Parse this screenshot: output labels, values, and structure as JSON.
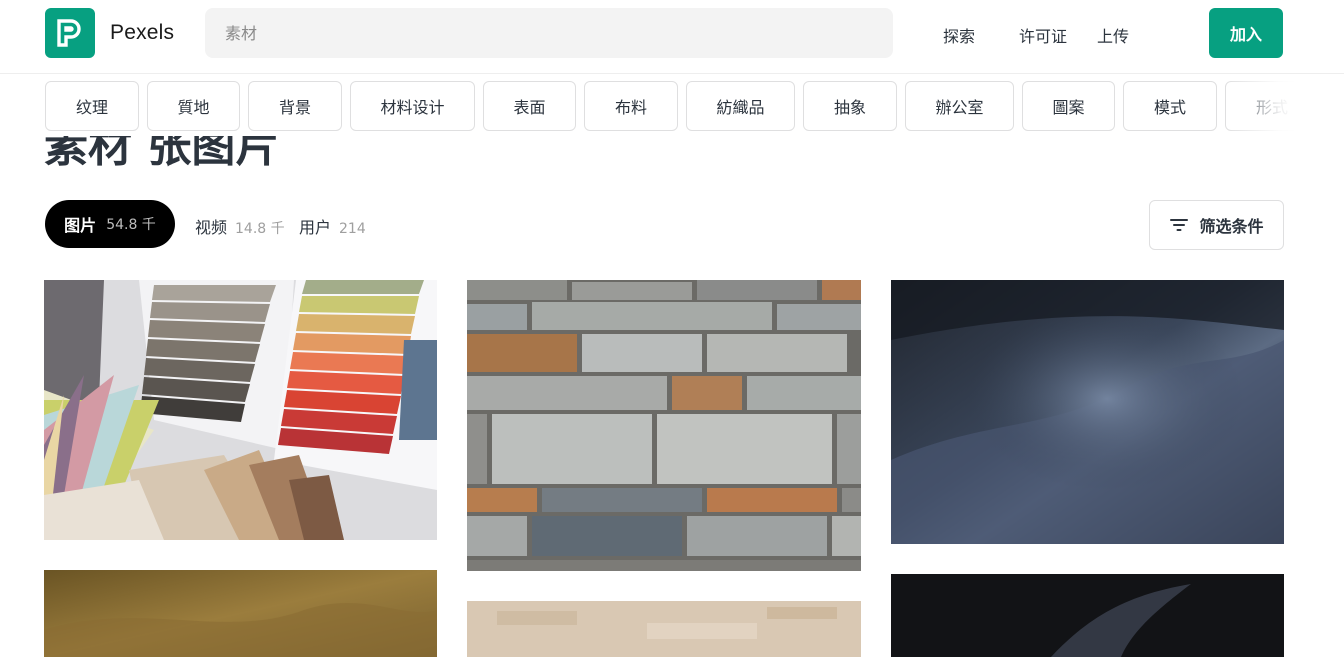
{
  "brand": {
    "name": "Pexels"
  },
  "search": {
    "placeholder": "素材",
    "value": ""
  },
  "nav": {
    "explore": "探索",
    "license": "许可证",
    "upload": "上传",
    "join": "加入"
  },
  "tags": [
    "纹理",
    "質地",
    "背景",
    "材料设计",
    "表面",
    "布料",
    "紡織品",
    "抽象",
    "辦公室",
    "圖案",
    "模式",
    "形式"
  ],
  "page": {
    "title": "素材 张图片"
  },
  "tabs": {
    "photos": {
      "label": "图片",
      "count": "54.8 千"
    },
    "videos": {
      "label": "视频",
      "count": "14.8 千"
    },
    "users": {
      "label": "用户",
      "count": "214"
    }
  },
  "filter": {
    "label": "筛选条件"
  },
  "colors": {
    "brand": "#07a081",
    "text": "#2c343e",
    "active_tab": "#000000"
  },
  "photos": [
    {
      "name": "fabric swatches and color fan"
    },
    {
      "name": "stone brick wall"
    },
    {
      "name": "dark blue satin fabric"
    },
    {
      "name": "brown fabric"
    },
    {
      "name": "beige textured surface"
    },
    {
      "name": "black fabric"
    }
  ]
}
